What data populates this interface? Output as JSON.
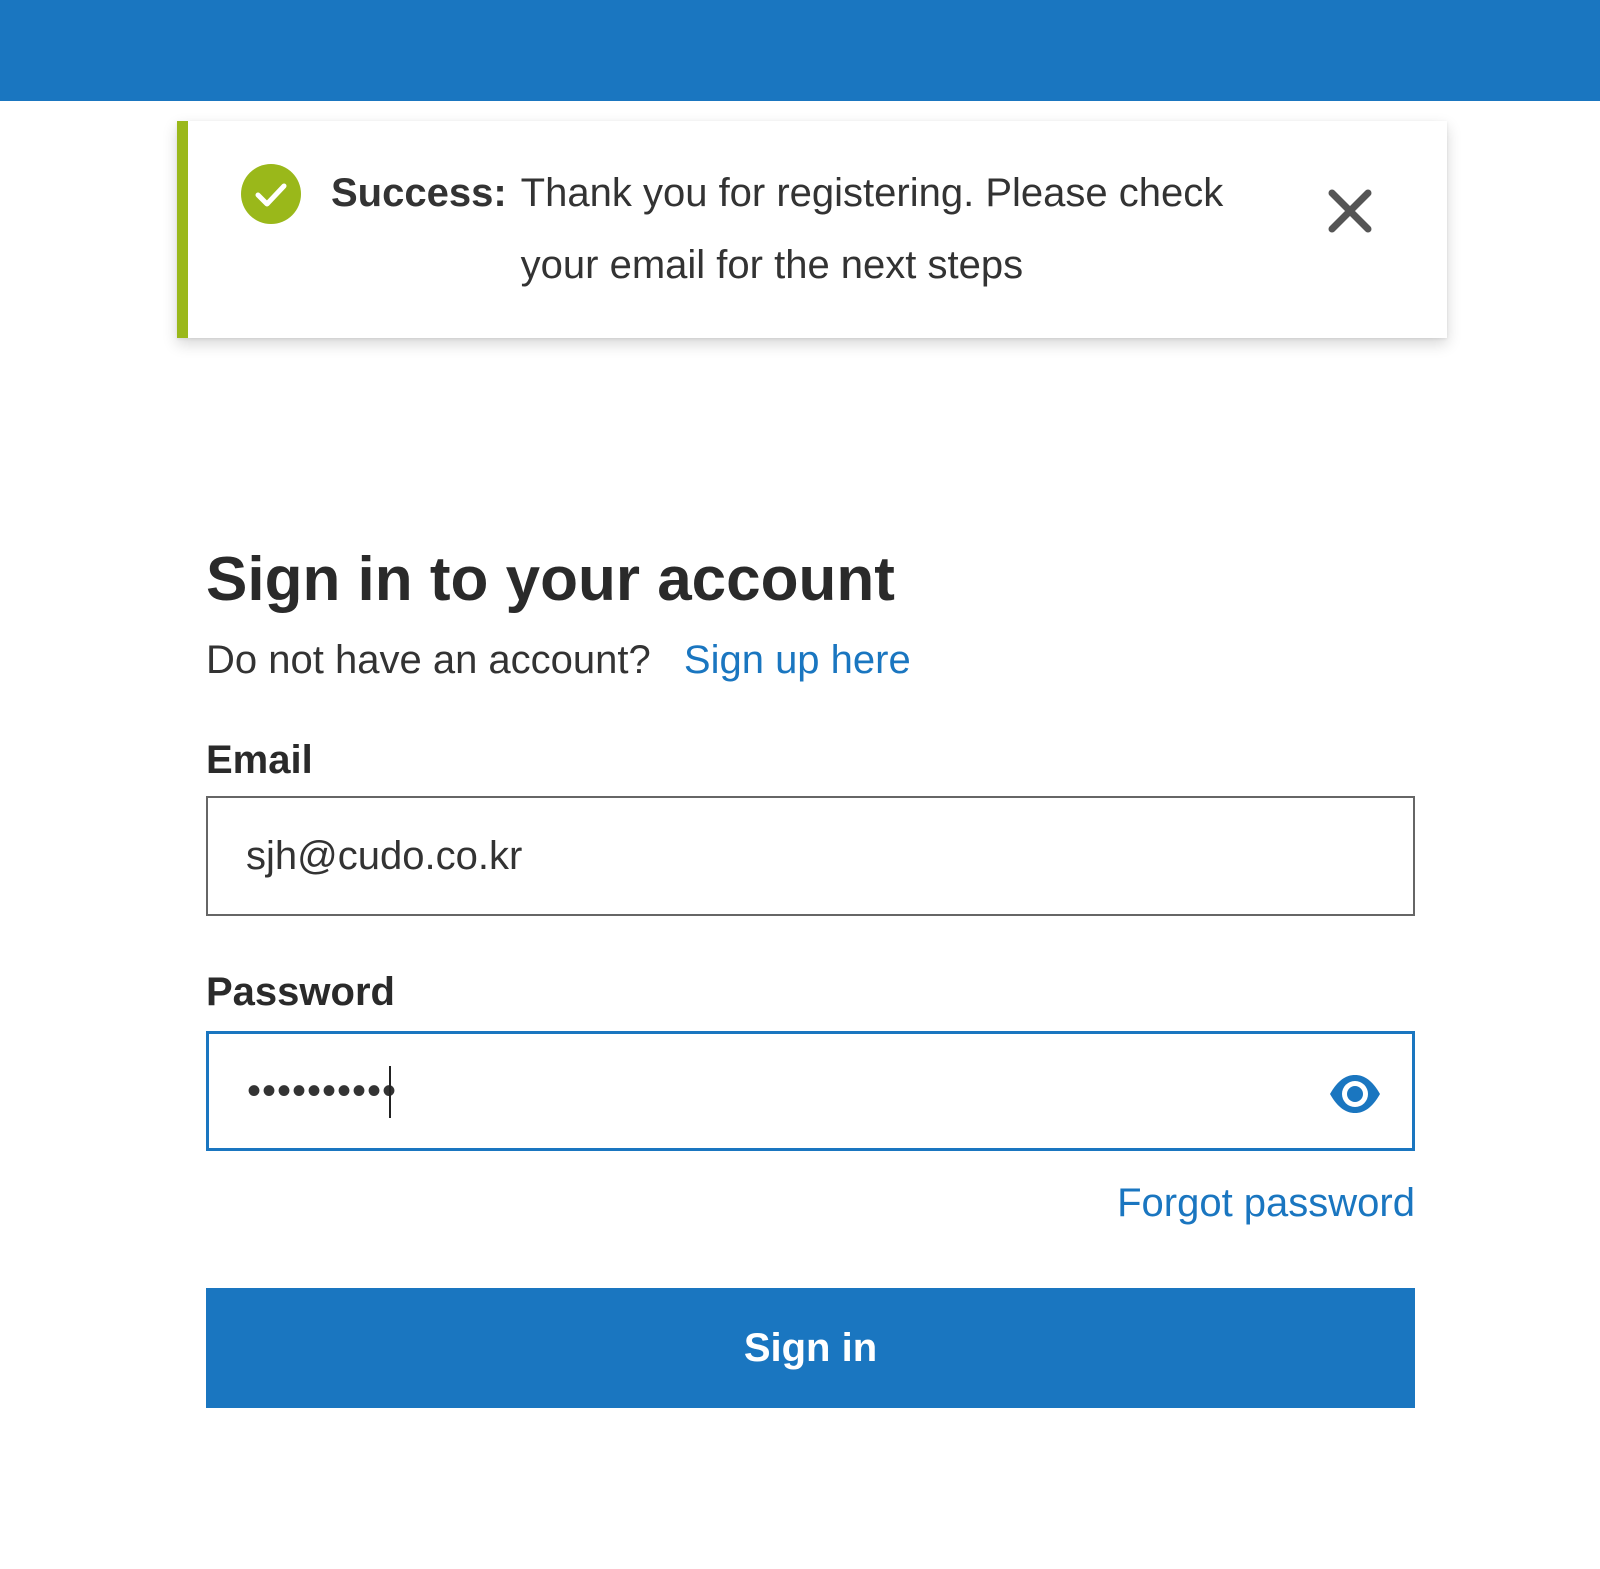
{
  "colors": {
    "brand": "#1a76c0",
    "success_accent": "#9ab81a"
  },
  "toast": {
    "icon": "check-circle-icon",
    "label": "Success:",
    "message": "Thank you for registering. Please check your email for the next steps",
    "close_icon": "close-icon"
  },
  "signin": {
    "heading": "Sign in to your account",
    "no_account_text": "Do not have an account?",
    "signup_link": "Sign up here",
    "email_label": "Email",
    "email_value": "sjh@cudo.co.kr",
    "password_label": "Password",
    "password_value": "••••••••••",
    "show_password_icon": "eye-icon",
    "forgot_password": "Forgot password",
    "submit_label": "Sign in"
  }
}
